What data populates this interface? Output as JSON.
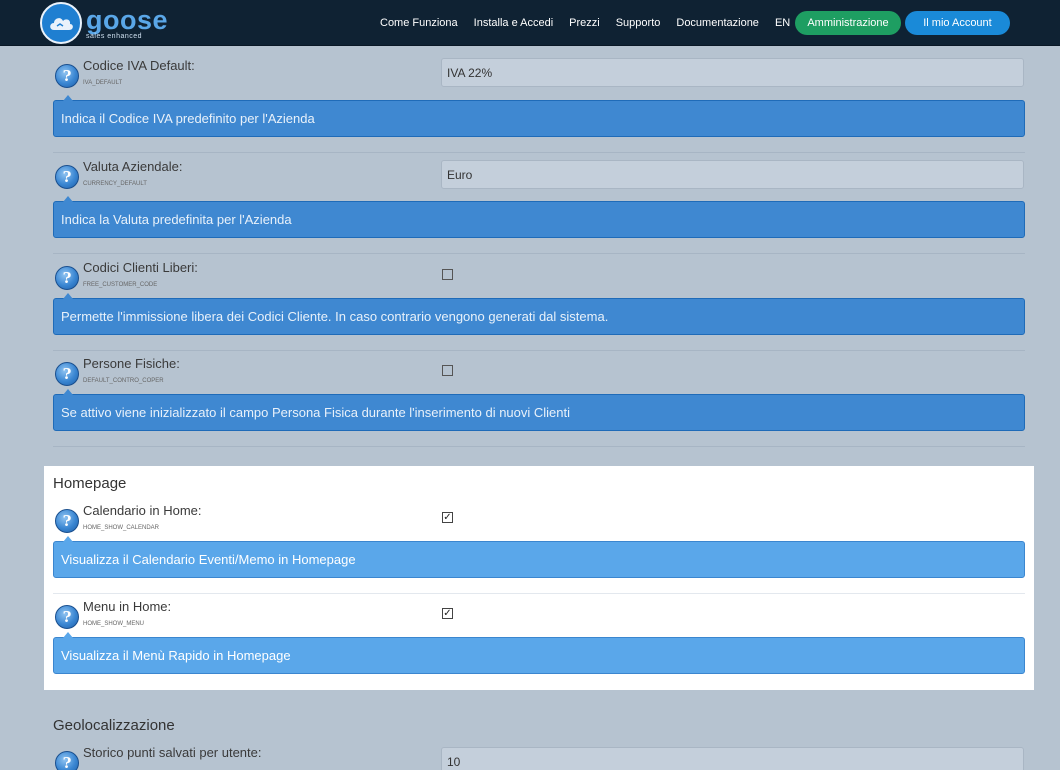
{
  "brand": {
    "name": "goose",
    "tagline": "sales enhanced"
  },
  "nav": {
    "links": [
      "Come Funziona",
      "Installa e Accedi",
      "Prezzi",
      "Supporto",
      "Documentazione",
      "EN"
    ],
    "admin_label": "Amministrazione",
    "account_label": "Il mio Account"
  },
  "settings": [
    {
      "label": "Codice IVA Default:",
      "code": "IVA_DEFAULT",
      "type": "text",
      "value": "IVA 22%",
      "description": "Indica il Codice IVA predefinito per l'Azienda"
    },
    {
      "label": "Valuta Aziendale:",
      "code": "CURRENCY_DEFAULT",
      "type": "text",
      "value": "Euro",
      "description": "Indica la Valuta predefinita per l'Azienda"
    },
    {
      "label": "Codici Clienti Liberi:",
      "code": "FREE_CUSTOMER_CODE",
      "type": "checkbox",
      "checked": false,
      "description": "Permette l'immissione libera dei Codici Cliente. In caso contrario vengono generati dal sistema."
    },
    {
      "label": "Persone Fisiche:",
      "code": "DEFAULT_CONTRO_COPER",
      "type": "checkbox",
      "checked": false,
      "description": "Se attivo viene inizializzato il campo Persona Fisica durante l'inserimento di nuovi Clienti"
    }
  ],
  "homepage": {
    "title": "Homepage",
    "settings": [
      {
        "label": "Calendario in Home:",
        "code": "HOME_SHOW_CALENDAR",
        "type": "checkbox",
        "checked": true,
        "description": "Visualizza il Calendario Eventi/Memo in Homepage"
      },
      {
        "label": "Menu in Home:",
        "code": "HOME_SHOW_MENU",
        "type": "checkbox",
        "checked": true,
        "description": "Visualizza il Menù Rapido in Homepage"
      }
    ]
  },
  "geo": {
    "title": "Geolocalizzazione",
    "settings": [
      {
        "label": "Storico punti salvati per utente:",
        "type": "text",
        "value": "10"
      }
    ]
  },
  "colors": {
    "navbar": "#0f2233",
    "admin_button": "#1e9e62",
    "account_button": "#1a8ad8",
    "description_box": "#3f88d1",
    "highlight_description_box": "#5aa7ea"
  }
}
